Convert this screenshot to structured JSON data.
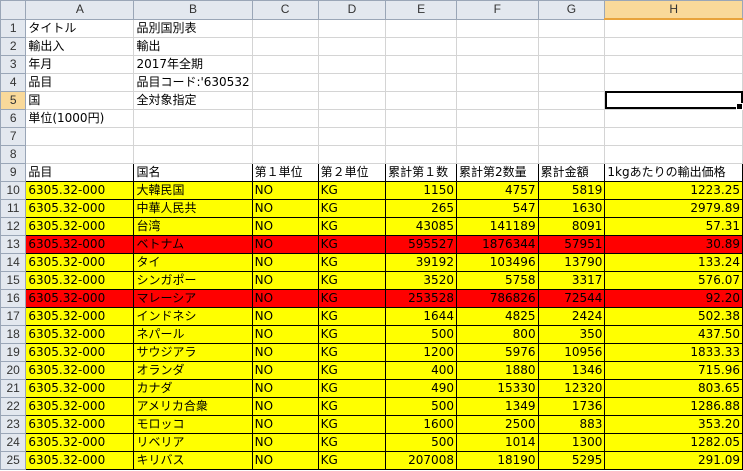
{
  "columns": [
    "A",
    "B",
    "C",
    "D",
    "E",
    "F",
    "G",
    "H"
  ],
  "meta_rows": [
    {
      "row": "1",
      "label": "タイトル",
      "value": "品別国別表"
    },
    {
      "row": "2",
      "label": "輸出入",
      "value": "輸出"
    },
    {
      "row": "3",
      "label": "年月",
      "value": "2017年全期"
    },
    {
      "row": "4",
      "label": "品目",
      "value": "品目コード:'630532"
    },
    {
      "row": "5",
      "label": "国",
      "value": "全対象指定"
    },
    {
      "row": "6",
      "label": "単位(1000円)",
      "value": ""
    },
    {
      "row": "7",
      "label": "",
      "value": ""
    },
    {
      "row": "8",
      "label": "",
      "value": ""
    }
  ],
  "header_row": {
    "row": "9",
    "cells": [
      "品目",
      "国名",
      "第１単位",
      "第２単位",
      "累計第１数",
      "累計第2数量",
      "累計金額",
      "1kgあたりの輸出価格"
    ]
  },
  "data_rows": [
    {
      "row": "10",
      "fill": "yellow",
      "cells": [
        "6305.32-000",
        "大韓民国",
        "NO",
        "KG",
        "1150",
        "4757",
        "5819",
        "1223.25"
      ]
    },
    {
      "row": "11",
      "fill": "yellow",
      "cells": [
        "6305.32-000",
        "中華人民共",
        "NO",
        "KG",
        "265",
        "547",
        "1630",
        "2979.89"
      ]
    },
    {
      "row": "12",
      "fill": "yellow",
      "cells": [
        "6305.32-000",
        "台湾",
        "NO",
        "KG",
        "43085",
        "141189",
        "8091",
        "57.31"
      ]
    },
    {
      "row": "13",
      "fill": "red",
      "cells": [
        "6305.32-000",
        "ベトナム",
        "NO",
        "KG",
        "595527",
        "1876344",
        "57951",
        "30.89"
      ]
    },
    {
      "row": "14",
      "fill": "yellow",
      "cells": [
        "6305.32-000",
        "タイ",
        "NO",
        "KG",
        "39192",
        "103496",
        "13790",
        "133.24"
      ]
    },
    {
      "row": "15",
      "fill": "yellow",
      "cells": [
        "6305.32-000",
        "シンガポー",
        "NO",
        "KG",
        "3520",
        "5758",
        "3317",
        "576.07"
      ]
    },
    {
      "row": "16",
      "fill": "red",
      "cells": [
        "6305.32-000",
        "マレーシア",
        "NO",
        "KG",
        "253528",
        "786826",
        "72544",
        "92.20"
      ]
    },
    {
      "row": "17",
      "fill": "yellow",
      "cells": [
        "6305.32-000",
        "インドネシ",
        "NO",
        "KG",
        "1644",
        "4825",
        "2424",
        "502.38"
      ]
    },
    {
      "row": "18",
      "fill": "yellow",
      "cells": [
        "6305.32-000",
        "ネパール",
        "NO",
        "KG",
        "500",
        "800",
        "350",
        "437.50"
      ]
    },
    {
      "row": "19",
      "fill": "yellow",
      "cells": [
        "6305.32-000",
        "サウジアラ",
        "NO",
        "KG",
        "1200",
        "5976",
        "10956",
        "1833.33"
      ]
    },
    {
      "row": "20",
      "fill": "yellow",
      "cells": [
        "6305.32-000",
        "オランダ",
        "NO",
        "KG",
        "400",
        "1880",
        "1346",
        "715.96"
      ]
    },
    {
      "row": "21",
      "fill": "yellow",
      "cells": [
        "6305.32-000",
        "カナダ",
        "NO",
        "KG",
        "490",
        "15330",
        "12320",
        "803.65"
      ]
    },
    {
      "row": "22",
      "fill": "yellow",
      "cells": [
        "6305.32-000",
        "アメリカ合衆",
        "NO",
        "KG",
        "500",
        "1349",
        "1736",
        "1286.88"
      ]
    },
    {
      "row": "23",
      "fill": "yellow",
      "cells": [
        "6305.32-000",
        "モロッコ",
        "NO",
        "KG",
        "1600",
        "2500",
        "883",
        "353.20"
      ]
    },
    {
      "row": "24",
      "fill": "yellow",
      "cells": [
        "6305.32-000",
        "リベリア",
        "NO",
        "KG",
        "500",
        "1014",
        "1300",
        "1282.05"
      ]
    },
    {
      "row": "25",
      "fill": "yellow",
      "cells": [
        "6305.32-000",
        "キリバス",
        "NO",
        "KG",
        "207008",
        "18190",
        "5295",
        "291.09"
      ]
    }
  ],
  "colors": {
    "highlight": "#ffff00",
    "alert": "#ff0000",
    "header_bg": "#e3e8ef",
    "selected_header": "#f9d99a"
  }
}
